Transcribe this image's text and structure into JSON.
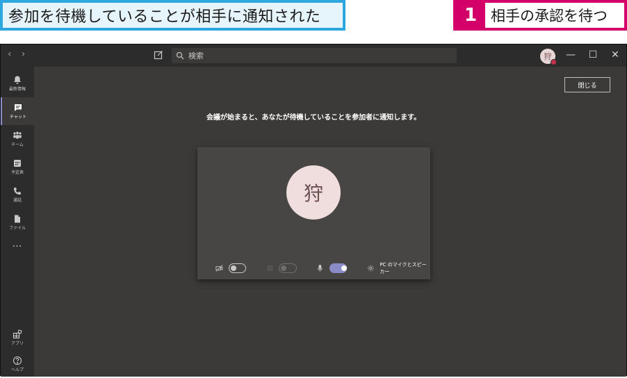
{
  "caption": {
    "left_text": "参加を待機していることが相手に通知された",
    "step_number": "1",
    "step_text": "相手の承認を待つ"
  },
  "titlebar": {
    "back_glyph": "‹",
    "forward_glyph": "›",
    "search_placeholder": "検索",
    "user_initial": "狩",
    "minimize_glyph": "—",
    "maximize_glyph": "☐",
    "close_glyph": "✕"
  },
  "sidebar": {
    "items": [
      {
        "label": "最新情報",
        "icon": "bell-icon"
      },
      {
        "label": "チャット",
        "icon": "chat-icon"
      },
      {
        "label": "チーム",
        "icon": "teams-icon"
      },
      {
        "label": "予定表",
        "icon": "calendar-icon"
      },
      {
        "label": "通話",
        "icon": "phone-icon"
      },
      {
        "label": "ファイル",
        "icon": "file-icon"
      },
      {
        "label": "アプリ",
        "icon": "apps-icon"
      },
      {
        "label": "ヘルプ",
        "icon": "help-icon"
      }
    ],
    "more_label": "…",
    "active_index": 1
  },
  "main": {
    "close_button_label": "閉じる",
    "notice_text": "会議が始まると、あなたが待機していることを参加者に通知します。",
    "preview_initial": "狩",
    "device_label": "PC のマイクとスピーカー",
    "toggles": {
      "camera_on": false,
      "blur_on": false,
      "mic_on": true
    }
  },
  "colors": {
    "caption_blue": "#2ea7e0",
    "caption_magenta": "#d4006a",
    "accent": "#8b8cc7",
    "background": "#3b3a39"
  }
}
